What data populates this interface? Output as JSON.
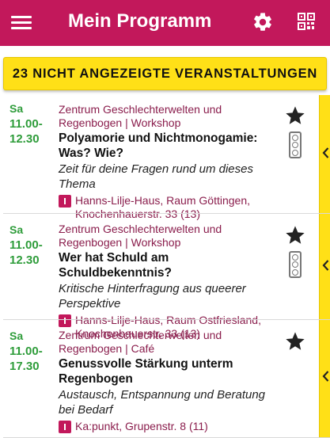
{
  "header": {
    "title": "Mein Programm"
  },
  "banner": {
    "label": "23 NICHT ANGEZEIGTE VERANSTALTUNGEN"
  },
  "events": [
    {
      "day": "Sa",
      "start": "11.00-",
      "end": "12.30",
      "org": "Zentrum Geschlechterwelten und Regenbogen | Workshop",
      "title": "Polyamorie und Nichtmonogamie: Was? Wie?",
      "subtitle": "Zeit für deine Fragen rund um dieses Thema",
      "location": "Hanns-Lilje-Haus, Raum Göttingen, Knochenhauerstr. 33 (13)"
    },
    {
      "day": "Sa",
      "start": "11.00-",
      "end": "12.30",
      "org": "Zentrum Geschlechterwelten und Regenbogen | Workshop",
      "title": "Wer hat Schuld am Schuldbekenntnis?",
      "subtitle": "Kritische Hinterfragung aus queerer Perspektive",
      "location": "Hanns-Lilje-Haus, Raum Ostfriesland, Knochenhauerstr. 33 (13)"
    },
    {
      "day": "Sa",
      "start": "11.00-",
      "end": "17.30",
      "org": "Zentrum Geschlechterwelten und Regenbogen | Café",
      "title": "Genussvolle Stärkung unterm Regenbogen",
      "subtitle": "Austausch, Entspannung und Beratung bei Bedarf",
      "location": "Ka:punkt, Grupenstr. 8 (11)"
    }
  ],
  "colors": {
    "appbar": "#c2185b",
    "banner": "#ffe017",
    "time": "#2e9c3a",
    "org": "#8a1d4c"
  },
  "icons": {
    "menu": "menu-icon",
    "settings": "gear-icon",
    "qr": "qr-code-icon",
    "favorite": "star-icon",
    "traffic": "traffic-light-icon",
    "location": "location-pin-icon",
    "expand": "chevron-left-icon"
  }
}
